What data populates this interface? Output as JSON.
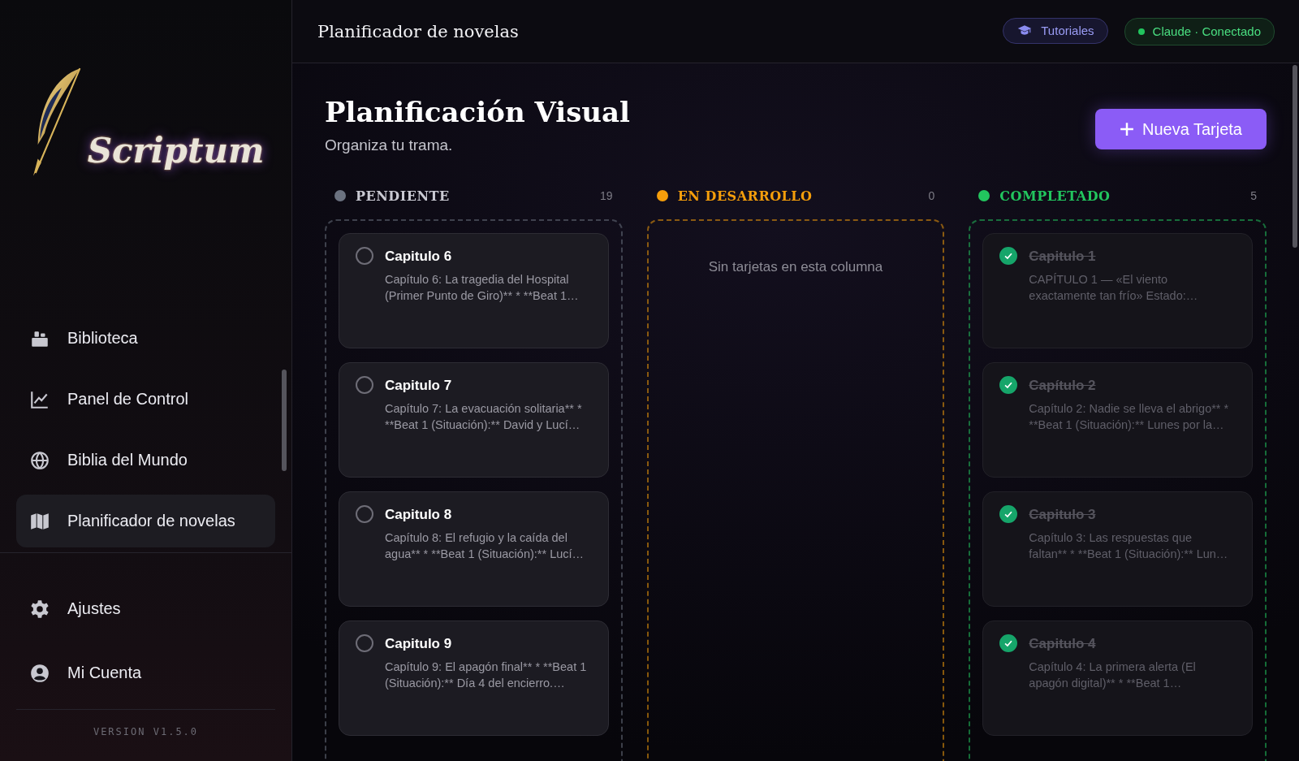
{
  "logo": {
    "text": "Scriptum"
  },
  "sidebar": {
    "items": [
      {
        "label": "Biblioteca",
        "selected": false
      },
      {
        "label": "Panel de Control",
        "selected": false
      },
      {
        "label": "Biblia del Mundo",
        "selected": false
      },
      {
        "label": "Planificador de novelas",
        "selected": true
      }
    ],
    "bottom_items": [
      {
        "label": "Ajustes"
      },
      {
        "label": "Mi Cuenta"
      }
    ],
    "version": "VERSION V1.5.0"
  },
  "header": {
    "title": "Planificador de novelas",
    "tutorials": "Tutoriales",
    "status": "Claude · Conectado"
  },
  "page": {
    "title": "Planificación Visual",
    "subtitle": "Organiza tu trama.",
    "new_button": "Nueva Tarjeta"
  },
  "columns": [
    {
      "title": "PENDIENTE",
      "count": "19",
      "color": "#6b7280",
      "cards": [
        {
          "title": "Capitulo 6",
          "text": "Capítulo 6: La tragedia del Hospital (Primer Punto de Giro)** * **Beat 1…",
          "done": false
        },
        {
          "title": "Capitulo 7",
          "text": "Capítulo 7: La evacuación solitaria** * **Beat 1 (Situación):** David y Lucí…",
          "done": false
        },
        {
          "title": "Capitulo 8",
          "text": "Capítulo 8: El refugio y la caída del agua** * **Beat 1 (Situación):** Lucí…",
          "done": false
        },
        {
          "title": "Capitulo 9",
          "text": "Capítulo 9: El apagón final** * **Beat 1 (Situación):** Día 4 del encierro.…",
          "done": false
        }
      ]
    },
    {
      "title": "EN DESARROLLO",
      "count": "0",
      "color": "#f59e0b",
      "empty_text": "Sin tarjetas en esta columna"
    },
    {
      "title": "COMPLETADO",
      "count": "5",
      "color": "#22c55e",
      "cards": [
        {
          "title": "Capitulo 1",
          "text": "CAPÍTULO 1 — «El viento exactamente tan frío» Estado:…",
          "done": true
        },
        {
          "title": "Capítulo 2",
          "text": "Capítulo 2: Nadie se lleva el abrigo** * **Beat 1 (Situación):** Lunes por la…",
          "done": true
        },
        {
          "title": "Capitulo 3",
          "text": "Capítulo 3: Las respuestas que faltan** * **Beat 1 (Situación):** Lun…",
          "done": true
        },
        {
          "title": "Capitulo 4",
          "text": "Capítulo 4: La primera alerta (El apagón digital)** * **Beat 1…",
          "done": true
        }
      ]
    }
  ]
}
